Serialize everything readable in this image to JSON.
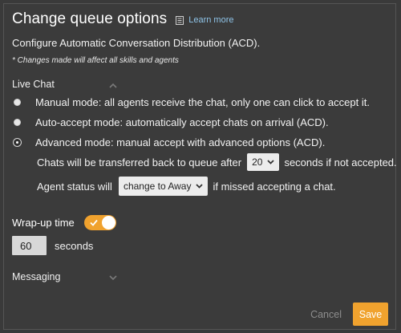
{
  "header": {
    "title": "Change queue options",
    "learn_more": "Learn more",
    "subtitle": "Configure Automatic Conversation Distribution (ACD).",
    "note": "* Changes made will affect all skills and agents"
  },
  "live_chat": {
    "label": "Live Chat",
    "options": [
      {
        "label": "Manual mode: all agents receive the chat, only one can click to accept it.",
        "checked": false
      },
      {
        "label": "Auto-accept mode: automatically accept chats on arrival (ACD).",
        "checked": false
      },
      {
        "label": "Advanced mode: manual accept with advanced options (ACD).",
        "checked": true
      }
    ],
    "transfer": {
      "prefix": "Chats will be transferred back to queue after",
      "value": "20",
      "suffix": "seconds if not accepted."
    },
    "status": {
      "prefix": "Agent status will",
      "value": "change to Away",
      "suffix": "if missed accepting a chat."
    }
  },
  "wrap_up": {
    "label": "Wrap-up time",
    "enabled": true,
    "value": "60",
    "unit": "seconds"
  },
  "messaging": {
    "label": "Messaging"
  },
  "footer": {
    "cancel_label": "Cancel",
    "save_label": "Save"
  },
  "colors": {
    "accent": "#f0a22e",
    "link": "#8fc4e8",
    "background": "#3b3b3b"
  }
}
